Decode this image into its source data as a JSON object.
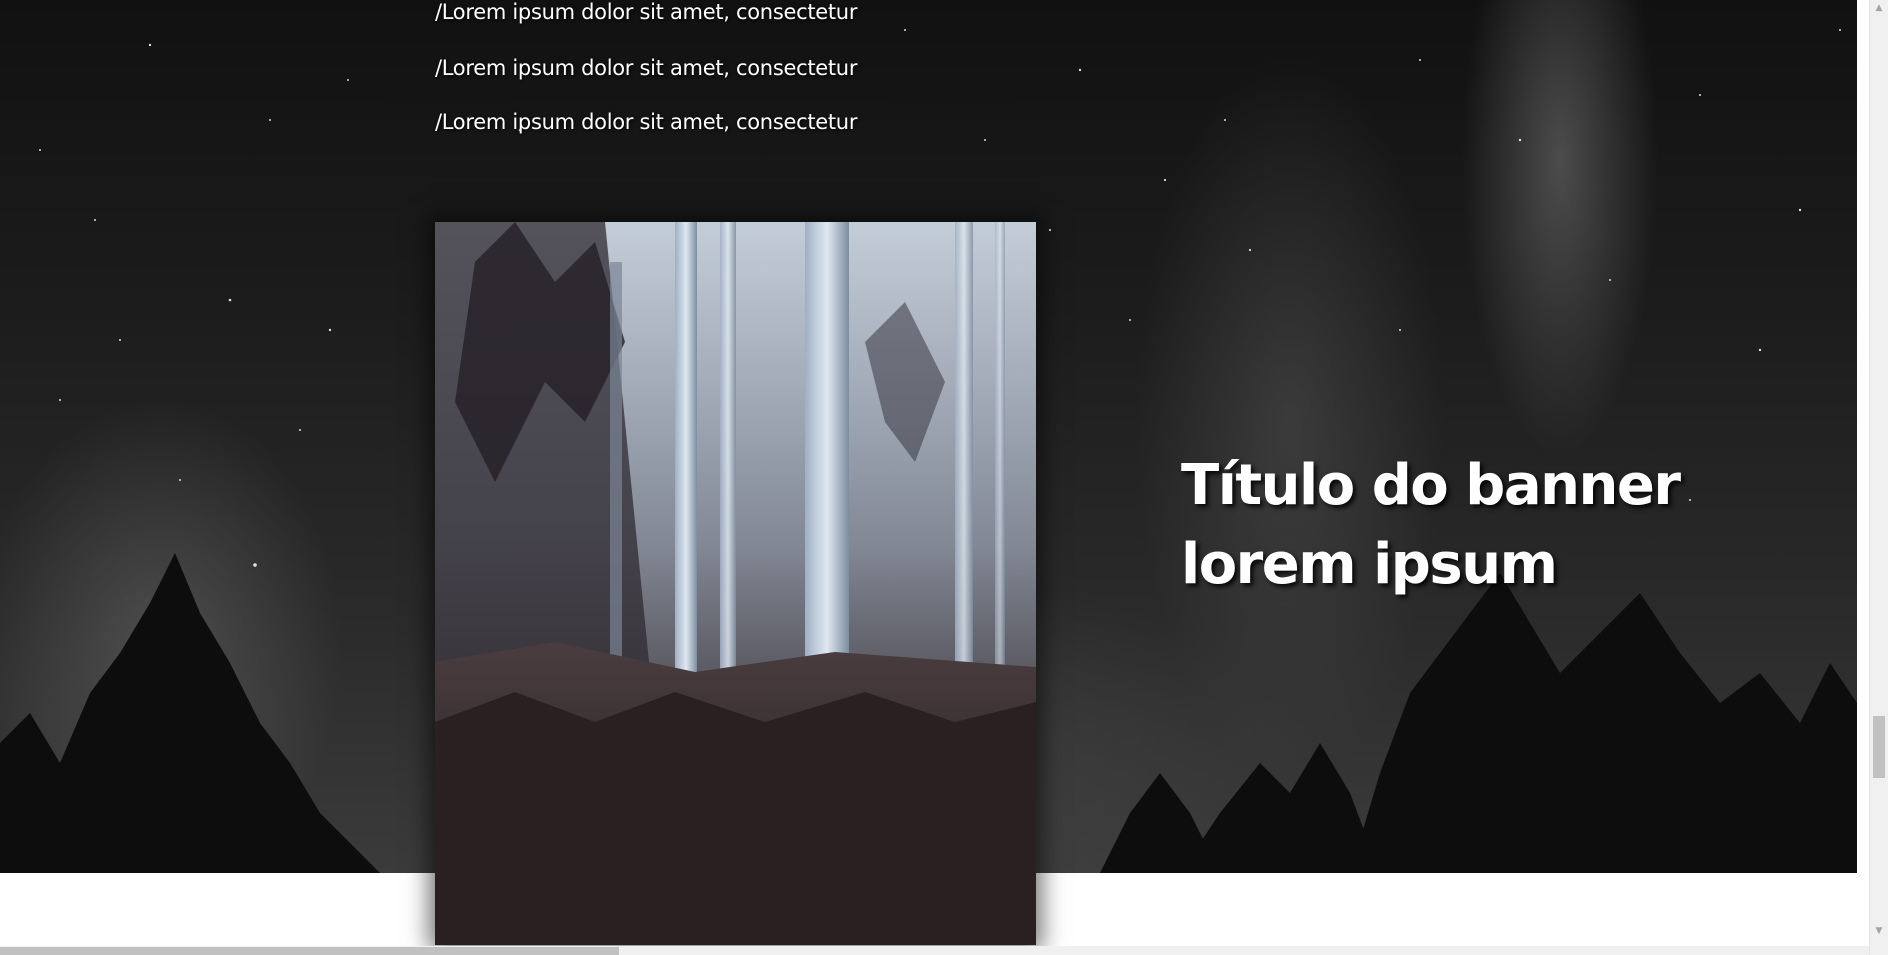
{
  "content": {
    "lines": [
      "/Lorem ipsum dolor sit amet, consectetur",
      "/Lorem ipsum dolor sit amet, consectetur",
      "/Lorem ipsum dolor sit amet, consectetur"
    ]
  },
  "banner": {
    "title_line1": "Título do banner",
    "title_line2": "lorem ipsum"
  },
  "icons": {
    "scroll_up": "triangle-up-icon",
    "scroll_down": "triangle-down-icon"
  },
  "colors": {
    "text": "#ffffff",
    "scrollbar_thumb": "#c1c1c1",
    "scrollbar_track": "#f0f0f0"
  }
}
